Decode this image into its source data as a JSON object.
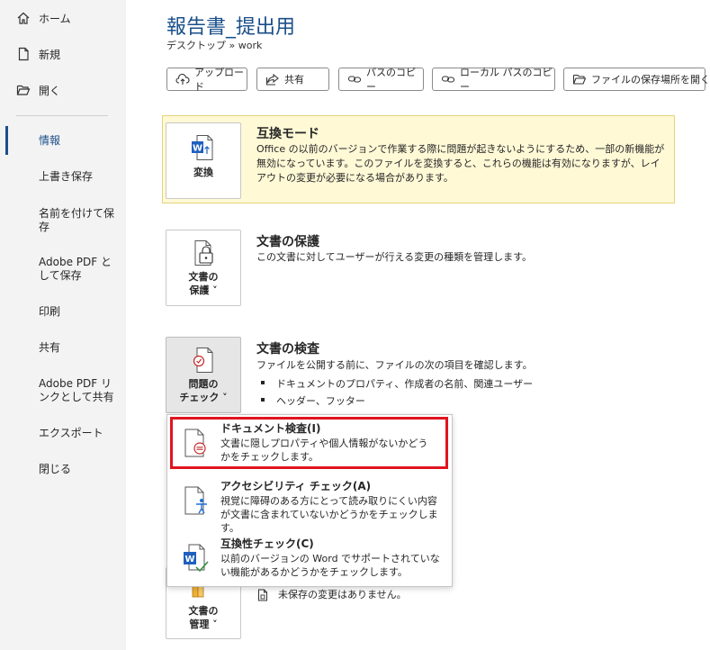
{
  "window": {
    "title": "報告書_提出用",
    "breadcrumb": "デスクトップ » work"
  },
  "sidebar": {
    "top_items": [
      {
        "label": "ホーム",
        "icon": "home-icon"
      },
      {
        "label": "新規",
        "icon": "new-file-icon"
      },
      {
        "label": "開く",
        "icon": "folder-open-icon"
      }
    ],
    "items": [
      {
        "label": "情報",
        "active": true
      },
      {
        "label": "上書き保存"
      },
      {
        "label": "名前を付けて保存"
      },
      {
        "label": "Adobe PDF として保存"
      },
      {
        "label": "印刷"
      },
      {
        "label": "共有"
      },
      {
        "label": "Adobe PDF リンクとして共有"
      },
      {
        "label": "エクスポート"
      },
      {
        "label": "閉じる"
      }
    ]
  },
  "toolbar": {
    "upload": "アップロード",
    "share": "共有",
    "copy_path": "パスのコピー",
    "copy_local_path": "ローカル パスのコピー",
    "open_location": "ファイルの保存場所を開く"
  },
  "compat": {
    "button_label": "変換",
    "title": "互換モード",
    "desc": "Office の以前のバージョンで作業する際に問題が起きないようにするため、一部の新機能が無効になっています。このファイルを変換すると、これらの機能は有効になりますが、レイアウトの変更が必要になる場合があります。"
  },
  "protect": {
    "button_line1": "文書の",
    "button_line2": "保護 ˅",
    "title": "文書の保護",
    "desc": "この文書に対してユーザーが行える変更の種類を管理します。"
  },
  "inspect": {
    "button_line1": "問題の",
    "button_line2": "チェック ˅",
    "title": "文書の検査",
    "desc": "ファイルを公開する前に、ファイルの次の項目を確認します。",
    "bullets": [
      "ドキュメントのプロパティ、作成者の名前、関連ユーザー",
      "ヘッダー、フッター"
    ]
  },
  "manage": {
    "button_line1": "文書の",
    "button_line2": "管理 ˅",
    "status": "未保存の変更はありません。"
  },
  "dropdown": {
    "items": [
      {
        "title": "ドキュメント検査(I)",
        "desc": "文書に隠しプロパティや個人情報がないかどうかをチェックします。",
        "icon": "document-inspect-icon",
        "highlighted": true
      },
      {
        "title": "アクセシビリティ チェック(A)",
        "desc": "視覚に障碍のある方にとって読み取りにくい内容が文書に含まれていないかどうかをチェックします。",
        "icon": "accessibility-check-icon"
      },
      {
        "title": "互換性チェック(C)",
        "desc": "以前のバージョンの Word でサポートされていない機能があるかどうかをチェックします。",
        "icon": "compatibility-check-icon"
      }
    ]
  },
  "colors": {
    "accent": "#1a4f8a",
    "highlight": "#e0141e",
    "compat_bg": "#fff9d6"
  }
}
